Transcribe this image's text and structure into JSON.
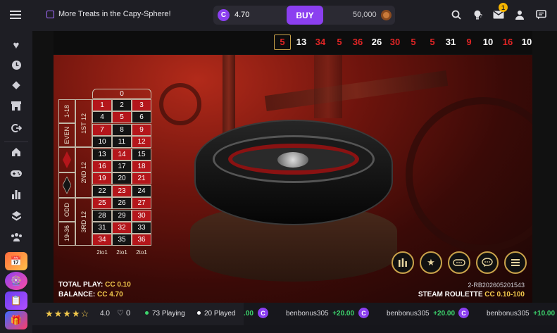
{
  "header": {
    "promo_text": "More Treats in the Capy-Sphere!",
    "coin_symbol": "C",
    "balance": "4.70",
    "buy_label": "BUY",
    "gold_balance": "50,000",
    "notification_count": "1"
  },
  "results": [
    {
      "value": "5",
      "color": "red"
    },
    {
      "value": "13",
      "color": "white"
    },
    {
      "value": "34",
      "color": "red"
    },
    {
      "value": "5",
      "color": "red"
    },
    {
      "value": "36",
      "color": "red"
    },
    {
      "value": "26",
      "color": "white"
    },
    {
      "value": "30",
      "color": "red"
    },
    {
      "value": "5",
      "color": "red"
    },
    {
      "value": "5",
      "color": "red"
    },
    {
      "value": "31",
      "color": "white"
    },
    {
      "value": "9",
      "color": "red"
    },
    {
      "value": "10",
      "color": "white"
    },
    {
      "value": "16",
      "color": "red"
    },
    {
      "value": "10",
      "color": "white"
    }
  ],
  "board": {
    "zero": "0",
    "rows": [
      [
        {
          "n": "1",
          "c": "red"
        },
        {
          "n": "2",
          "c": "black"
        },
        {
          "n": "3",
          "c": "red"
        }
      ],
      [
        {
          "n": "4",
          "c": "black"
        },
        {
          "n": "5",
          "c": "red"
        },
        {
          "n": "6",
          "c": "black"
        }
      ],
      [
        {
          "n": "7",
          "c": "red"
        },
        {
          "n": "8",
          "c": "black"
        },
        {
          "n": "9",
          "c": "red"
        }
      ],
      [
        {
          "n": "10",
          "c": "black"
        },
        {
          "n": "11",
          "c": "black"
        },
        {
          "n": "12",
          "c": "red"
        }
      ],
      [
        {
          "n": "13",
          "c": "black"
        },
        {
          "n": "14",
          "c": "red"
        },
        {
          "n": "15",
          "c": "black"
        }
      ],
      [
        {
          "n": "16",
          "c": "red"
        },
        {
          "n": "17",
          "c": "black"
        },
        {
          "n": "18",
          "c": "red"
        }
      ],
      [
        {
          "n": "19",
          "c": "red"
        },
        {
          "n": "20",
          "c": "black"
        },
        {
          "n": "21",
          "c": "red"
        }
      ],
      [
        {
          "n": "22",
          "c": "black"
        },
        {
          "n": "23",
          "c": "red"
        },
        {
          "n": "24",
          "c": "black"
        }
      ],
      [
        {
          "n": "25",
          "c": "red"
        },
        {
          "n": "26",
          "c": "black"
        },
        {
          "n": "27",
          "c": "red"
        }
      ],
      [
        {
          "n": "28",
          "c": "black"
        },
        {
          "n": "29",
          "c": "black"
        },
        {
          "n": "30",
          "c": "red"
        }
      ],
      [
        {
          "n": "31",
          "c": "black"
        },
        {
          "n": "32",
          "c": "red"
        },
        {
          "n": "33",
          "c": "black"
        }
      ],
      [
        {
          "n": "34",
          "c": "red"
        },
        {
          "n": "35",
          "c": "black"
        },
        {
          "n": "36",
          "c": "red"
        }
      ]
    ],
    "low": "1-18",
    "even": "EVEN",
    "odd": "ODD",
    "high": "19-36",
    "dozen1": "1ST 12",
    "dozen2": "2ND 12",
    "dozen3": "3RD 12",
    "column_label": "2to1"
  },
  "info": {
    "total_play_label": "TOTAL PLAY:",
    "total_play_value": "CC 0.10",
    "balance_label": "BALANCE:",
    "balance_value": "CC 4.70",
    "round_id": "2-RB202605201543",
    "game_name": "STEAM ROULETTE",
    "limits": "CC 0.10-100"
  },
  "footer": {
    "rating": "4.0",
    "likes": "0",
    "playing": "73 Playing",
    "played": "20 Played",
    "ticker": [
      {
        "user": "",
        "amount": ".00"
      },
      {
        "user": "benbonus305",
        "amount": "+20.00"
      },
      {
        "user": "benbonus305",
        "amount": "+20.00"
      },
      {
        "user": "benbonus305",
        "amount": "+10.00"
      }
    ]
  },
  "colors": {
    "accent": "#8b3ff0",
    "gold": "#f2c94c",
    "win_green": "#3dd56d",
    "result_red": "#e02525"
  },
  "icons": {
    "menu": "hamburger-icon",
    "search": "search-icon",
    "help": "lightbulb-icon",
    "mail": "mail-icon",
    "user": "user-icon",
    "chat": "chat-icon"
  }
}
